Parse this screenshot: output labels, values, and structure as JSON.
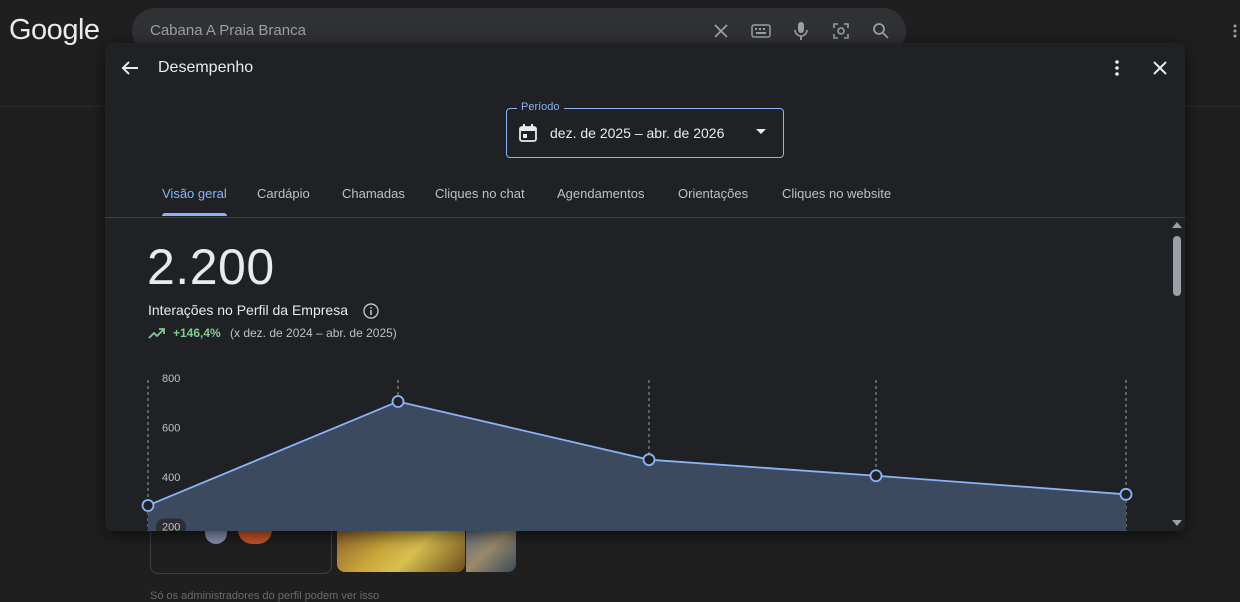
{
  "google": {
    "logo": "Google",
    "search_value": "Cabana A Praia Branca"
  },
  "background": {
    "note": "Só os administradores do perfil podem ver isso"
  },
  "dialog": {
    "title": "Desempenho",
    "period": {
      "label": "Período",
      "value": "dez. de 2025 – abr. de 2026"
    },
    "tabs": [
      {
        "label": "Visão geral",
        "active": true
      },
      {
        "label": "Cardápio"
      },
      {
        "label": "Chamadas"
      },
      {
        "label": "Cliques no chat"
      },
      {
        "label": "Agendamentos"
      },
      {
        "label": "Orientações"
      },
      {
        "label": "Cliques no website"
      }
    ],
    "metric": {
      "value": "2.200",
      "label": "Interações no Perfil da Empresa",
      "change": "+146,4%",
      "comparison": "(x dez. de 2024 – abr. de 2025)"
    }
  },
  "colors": {
    "accent": "#8ab4f8",
    "positive": "#81c995",
    "area_fill": "#3c4a60"
  },
  "chart_data": {
    "type": "area",
    "y_ticks": [
      "800",
      "600",
      "400",
      "200"
    ],
    "y_tick_values": [
      800,
      600,
      400,
      200
    ],
    "ylim": [
      0,
      800
    ],
    "values": [
      285,
      705,
      470,
      405,
      330
    ]
  }
}
